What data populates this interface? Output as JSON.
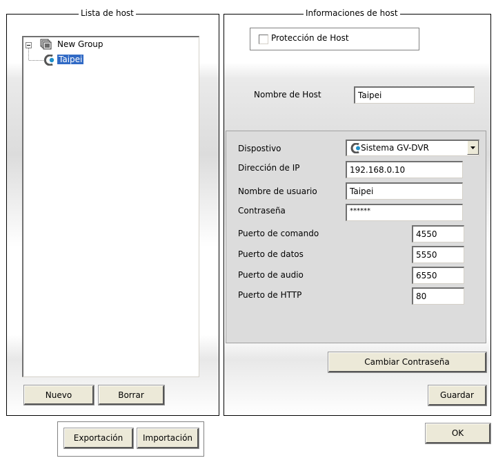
{
  "host_list": {
    "title": "Lista de host",
    "tree": {
      "group_label": "New Group",
      "host_label": "Taipei"
    },
    "new_button": "Nuevo",
    "delete_button": "Borrar"
  },
  "host_info": {
    "title": "Informaciones de host",
    "protection_label": "Protección de Host",
    "protection_checked": false,
    "host_name_label": "Nombre de Host",
    "host_name_value": "Taipei",
    "device_label": "Dispostivo",
    "device_value": "Sistema GV-DVR",
    "ip_label": "Dirección de IP",
    "ip_value": "192.168.0.10",
    "username_label": "Nombre de usuario",
    "username_value": "Taipei",
    "password_label": "Contraseña",
    "password_value": "******",
    "command_port_label": "Puerto de comando",
    "command_port_value": "4550",
    "data_port_label": "Puerto de datos",
    "data_port_value": "5550",
    "audio_port_label": "Puerto de audio",
    "audio_port_value": "6550",
    "http_port_label": "Puerto de HTTP",
    "http_port_value": "80",
    "change_password_button": "Cambiar Contraseña",
    "save_button": "Guardar"
  },
  "footer": {
    "export_button": "Exportación",
    "import_button": "Importación",
    "ok_button": "OK"
  }
}
